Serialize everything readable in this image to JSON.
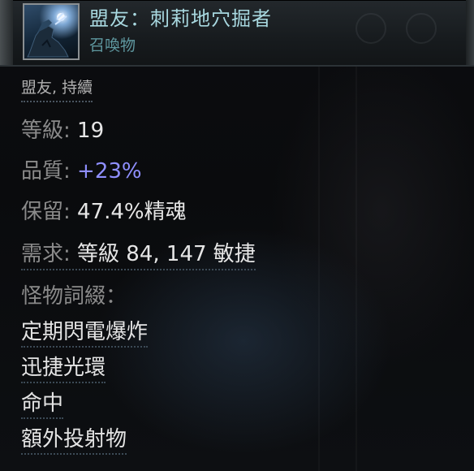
{
  "header": {
    "name": "盟友：刺莉地穴掘者",
    "type": "召喚物",
    "icon": "summon-gem-icon"
  },
  "tags": "盟友, 持續",
  "stats": {
    "level": {
      "label": "等級:",
      "value": "19"
    },
    "quality": {
      "label": "品質:",
      "value": "+23%"
    },
    "reservation": {
      "label": "保留:",
      "value": "47.4%精魂"
    },
    "requires": {
      "label": "需求:",
      "value": "等級 84, 147 敏捷"
    }
  },
  "monster_mods": {
    "heading": "怪物詞綴：",
    "items": [
      "定期閃電爆炸",
      "迅捷光環",
      "命中",
      "額外投射物"
    ]
  },
  "colors": {
    "name": "#a8d8e0",
    "type": "#5f98a0",
    "label": "#8a8a8a",
    "value": "#e6e6e6",
    "augmented": "#8f8fff"
  }
}
